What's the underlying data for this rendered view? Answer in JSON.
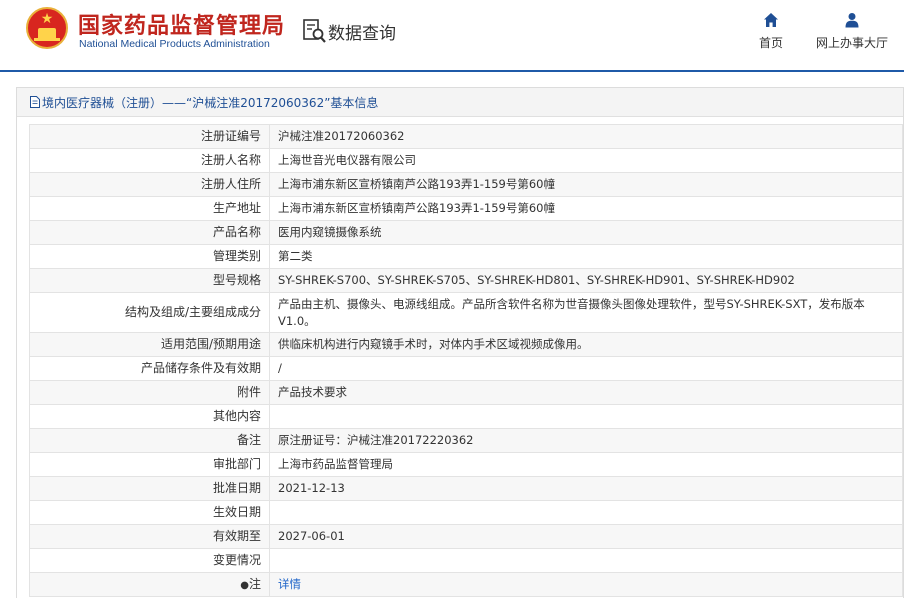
{
  "header": {
    "org_name_cn": "国家药品监督管理局",
    "org_name_en": "National Medical Products Administration",
    "query_label": "数据查询",
    "nav": [
      {
        "label": "首页",
        "icon": "home-icon"
      },
      {
        "label": "网上办事大厅",
        "icon": "user-icon"
      }
    ]
  },
  "panel": {
    "title": "境内医疗器械（注册）——“沪械注准20172060362”基本信息"
  },
  "records": [
    {
      "label": "注册证编号",
      "value": "沪械注准20172060362"
    },
    {
      "label": "注册人名称",
      "value": "上海世音光电仪器有限公司"
    },
    {
      "label": "注册人住所",
      "value": "上海市浦东新区宣桥镇南芦公路193弄1-159号第60幢"
    },
    {
      "label": "生产地址",
      "value": "上海市浦东新区宣桥镇南芦公路193弄1-159号第60幢"
    },
    {
      "label": "产品名称",
      "value": "医用内窥镜摄像系统"
    },
    {
      "label": "管理类别",
      "value": "第二类"
    },
    {
      "label": "型号规格",
      "value": "SY-SHREK-S700、SY-SHREK-S705、SY-SHREK-HD801、SY-SHREK-HD901、SY-SHREK-HD902"
    },
    {
      "label": "结构及组成/主要组成成分",
      "value": "产品由主机、摄像头、电源线组成。产品所含软件名称为世音摄像头图像处理软件，型号SY-SHREK-SXT，发布版本V1.0。"
    },
    {
      "label": "适用范围/预期用途",
      "value": "供临床机构进行内窥镜手术时，对体内手术区域视频成像用。"
    },
    {
      "label": "产品储存条件及有效期",
      "value": "/"
    },
    {
      "label": "附件",
      "value": "产品技术要求"
    },
    {
      "label": "其他内容",
      "value": ""
    },
    {
      "label": "备注",
      "value": "原注册证号：沪械注准20172220362"
    },
    {
      "label": "审批部门",
      "value": "上海市药品监督管理局"
    },
    {
      "label": "批准日期",
      "value": "2021-12-13"
    },
    {
      "label": "生效日期",
      "value": ""
    },
    {
      "label": "有效期至",
      "value": "2027-06-01"
    },
    {
      "label": "变更情况",
      "value": ""
    },
    {
      "label": "注",
      "value": "详情"
    }
  ],
  "colors": {
    "brand_red": "#c0261e",
    "brand_blue": "#1f4f95",
    "link_blue": "#1e64c8"
  }
}
